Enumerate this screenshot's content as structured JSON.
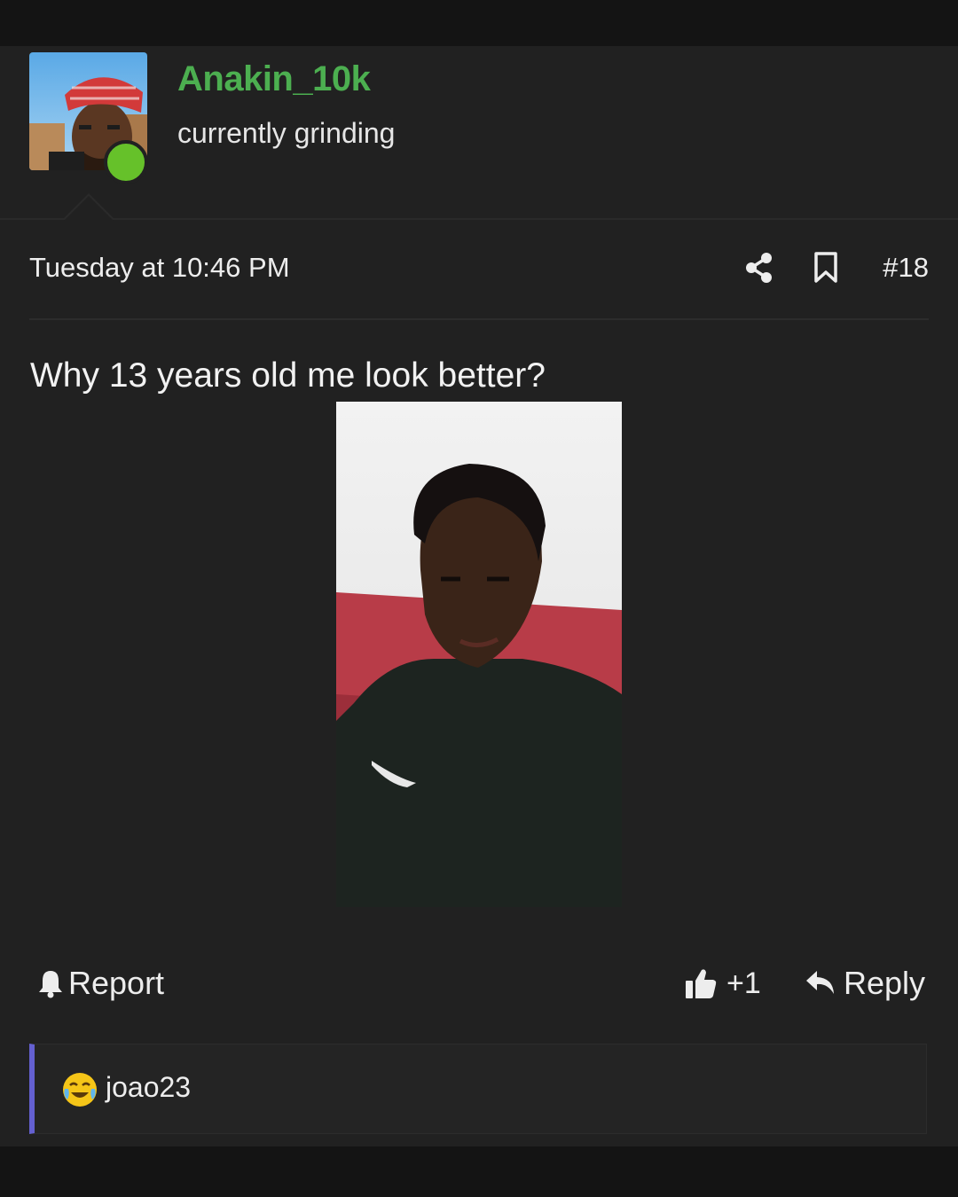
{
  "post": {
    "author": {
      "username": "Anakin_10k",
      "user_title": "currently grinding",
      "avatar_icon": "avatar-photo",
      "online_status": "online",
      "username_color": "#4caf50",
      "online_color": "#66c12a"
    },
    "timestamp": "Tuesday at 10:46 PM",
    "post_number": "#18",
    "header_icons": [
      "share-icon",
      "bookmark-icon"
    ],
    "message": "Why 13 years old me look better?",
    "image_icon": "attached-selfie-photo",
    "actions": {
      "report_label": "Report",
      "like_label": "+1",
      "reply_label": "Reply",
      "icons": [
        "bell-icon",
        "thumbs-up-icon",
        "reply-arrow-icon"
      ]
    },
    "reactions": {
      "emoji_icon": "crying-laughing-emoji-icon",
      "users": "joao23",
      "accent_color": "#6460d0"
    }
  }
}
